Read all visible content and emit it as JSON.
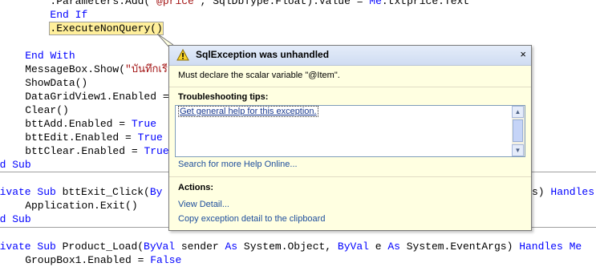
{
  "code": {
    "lines": [
      "        .Parameters.Add(\"@price\", SqlDbType.Float).Value = Me.txtprice.Text",
      "        End If",
      "        .ExecuteNonQuery()",
      "",
      "    End With",
      "    MessageBox.Show(\"บันทึกเรีย",
      "    ShowData()",
      "    DataGridView1.Enabled =",
      "    Clear()",
      "    bttAdd.Enabled = True",
      "    bttEdit.Enabled = True",
      "    bttClear.Enabled = True",
      "End Sub",
      "",
      "Private Sub bttExit_Click(By",
      "    Application.Exit()",
      "End Sub",
      "",
      "Private Sub Product_Load(ByVal sender As System.Object, ByVal e As System.EventArgs) Handles Me",
      "    GroupBox1.Enabled = False"
    ],
    "right_fragment": "s) Handles"
  },
  "popup": {
    "title": "SqlException was unhandled",
    "close": "×",
    "message": "Must declare the scalar variable \"@Item\".",
    "tips_heading": "Troubleshooting tips:",
    "tip_link": "Get general help for this exception.",
    "search_link": "Search for more Help Online...",
    "actions_heading": "Actions:",
    "actions": [
      "View Detail...",
      "Copy exception detail to the clipboard"
    ]
  },
  "icons": {
    "warning": "warning-icon",
    "close": "close-icon"
  },
  "colors": {
    "keyword": "#0000ff",
    "string": "#a31515",
    "popup_bg": "#ffffe1",
    "highlight": "#ffef9b"
  }
}
